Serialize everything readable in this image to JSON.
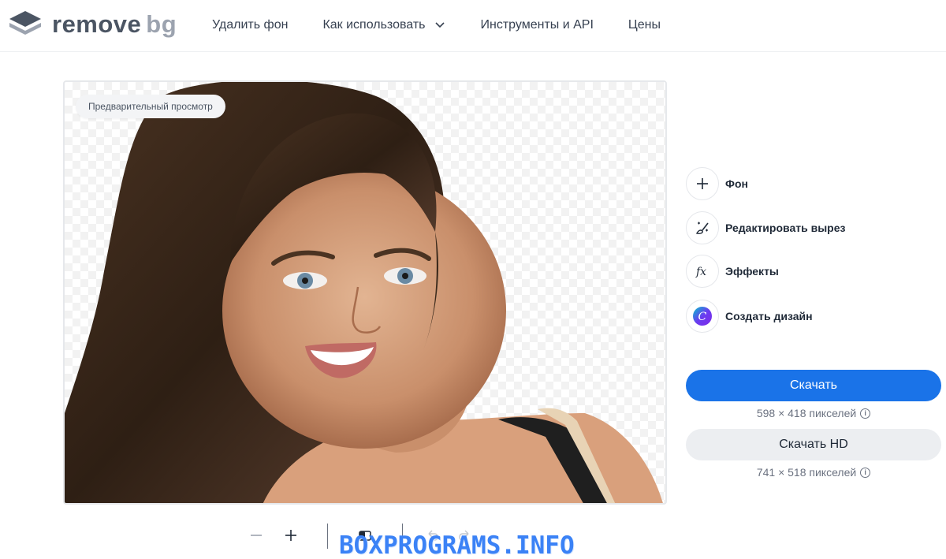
{
  "brand": {
    "name": "remove",
    "suffix": "bg"
  },
  "nav": {
    "items": [
      {
        "label": "Удалить фон"
      },
      {
        "label": "Как использовать"
      },
      {
        "label": "Инструменты и API"
      },
      {
        "label": "Цены"
      }
    ]
  },
  "preview": {
    "badge": "Предварительный просмотр"
  },
  "tools": [
    {
      "label": "Фон",
      "icon": "plus-icon"
    },
    {
      "label": "Редактировать вырез",
      "icon": "magic-brush-icon"
    },
    {
      "label": "Эффекты",
      "icon": "fx-icon"
    },
    {
      "label": "Создать дизайн",
      "icon": "canva-icon"
    }
  ],
  "download": {
    "label": "Скачать",
    "resolution": "598 × 418 пикселей"
  },
  "download_hd": {
    "label": "Скачать HD",
    "resolution": "741 × 518 пикселей"
  },
  "toolbar": {
    "icons": [
      "zoom-out-icon",
      "zoom-in-icon",
      "compare-icon",
      "undo-icon",
      "redo-icon"
    ]
  },
  "watermark": "BOXPROGRAMS.INFO",
  "colors": {
    "primary": "#1a73e8",
    "secondary": "#eceef1",
    "text": "#1f2937",
    "muted": "#6b7280"
  }
}
